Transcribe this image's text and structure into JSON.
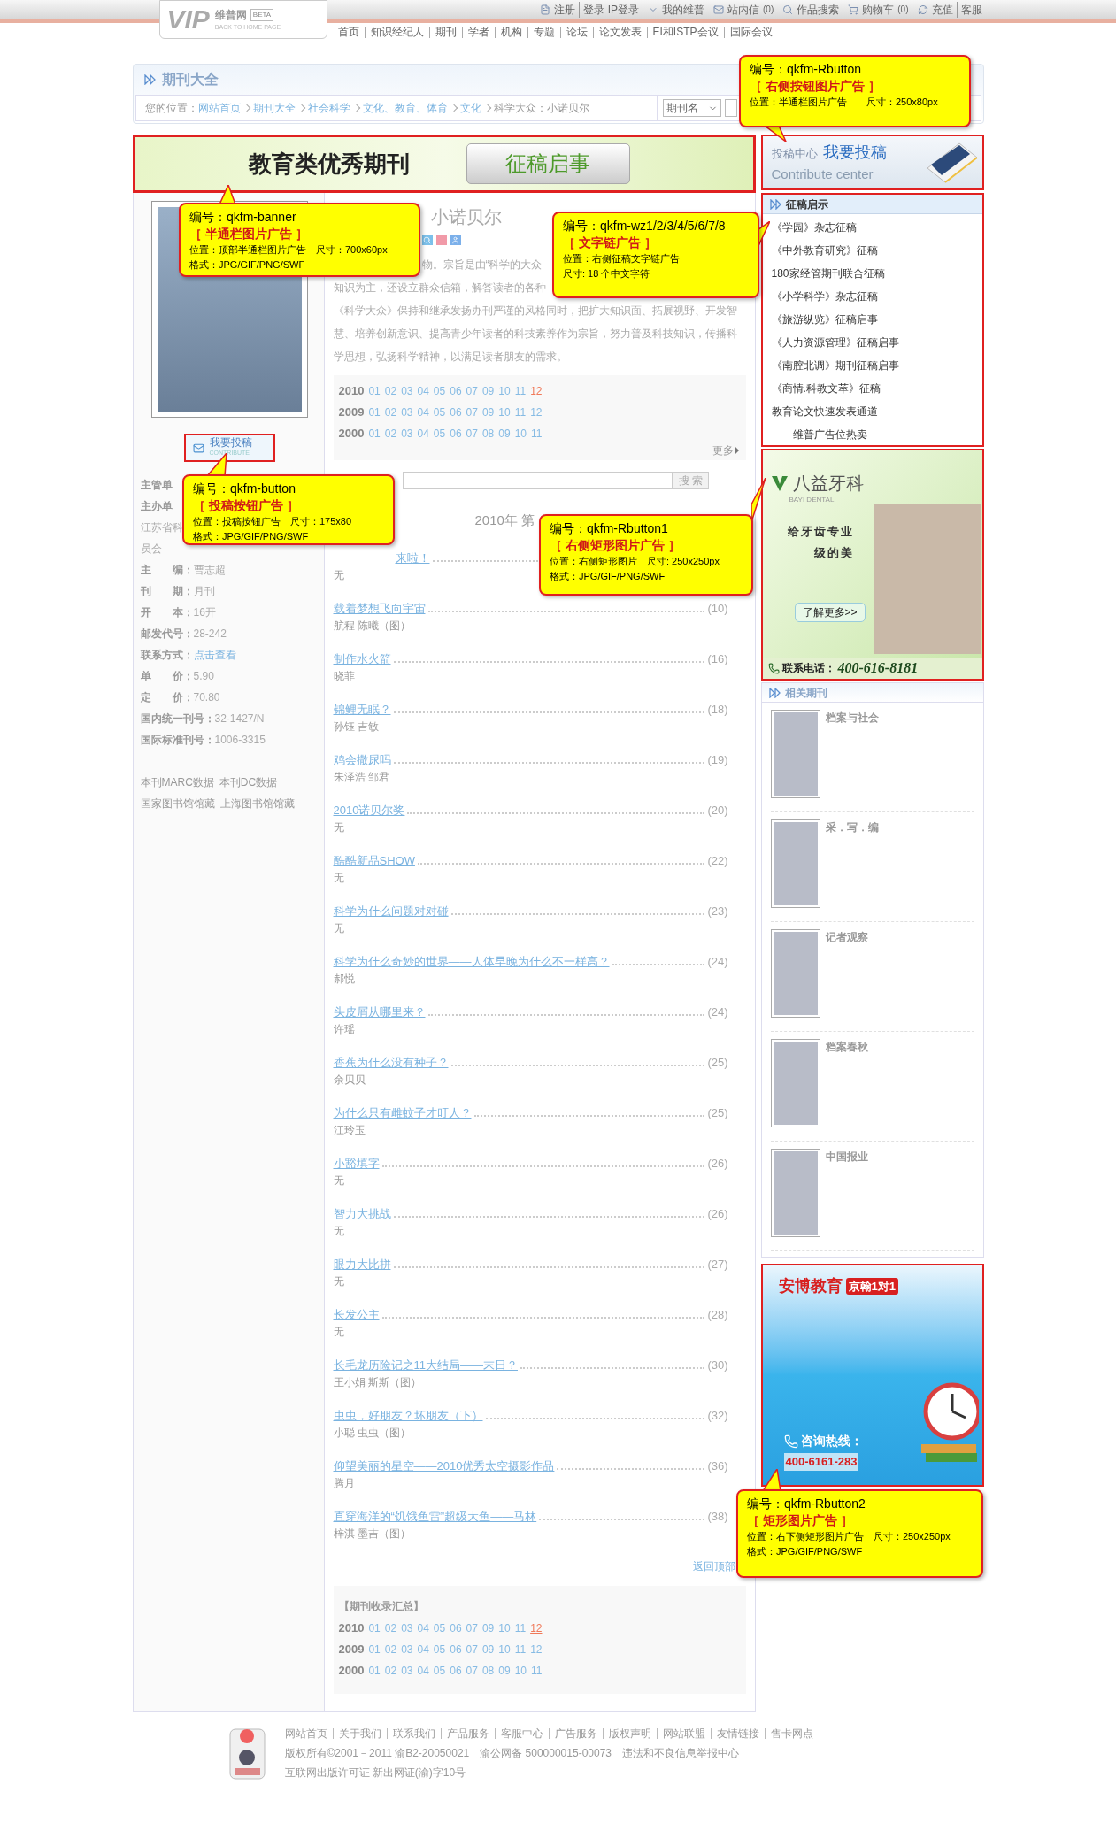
{
  "header": {
    "logo": {
      "mark": "VIP",
      "brand": "维普网",
      "badge": "BETA",
      "tagline": "BACK TO HOME PAGE"
    },
    "user_links": [
      {
        "kind": "register",
        "items": [
          "注册",
          "登录 IP登录"
        ]
      },
      {
        "kind": "account",
        "items": [
          "我的维普"
        ]
      },
      {
        "kind": "mail",
        "items": [
          "站内信"
        ],
        "count": "(0)"
      },
      {
        "kind": "search",
        "items": [
          "作品搜索"
        ]
      },
      {
        "kind": "cart",
        "items": [
          "购物车"
        ],
        "count": "(0)"
      },
      {
        "kind": "recharge",
        "items": [
          "充值",
          "客服"
        ]
      }
    ],
    "nav": [
      "首页",
      "知识经纪人",
      "期刊",
      "学者",
      "机构",
      "专题",
      "论坛",
      "论文发表",
      "EI和ISTP会议",
      "国际会议"
    ]
  },
  "section": {
    "title": "期刊大全",
    "breadcrumb": {
      "label": "您的位置：",
      "links": [
        "网站首页",
        "期刊大全",
        "社会科学",
        "文化、教育、体育",
        "文化"
      ],
      "current": "科学大众：小诺贝尔"
    },
    "search_select": "期刊名"
  },
  "banner_ad": {
    "headline": "教育类优秀期刊",
    "button": "征稿启事"
  },
  "journal_info": {
    "contribute_button": {
      "label": "我要投稿",
      "sublabel": "CONTRIBUTE"
    },
    "covered_lines": [
      {
        "kind": "label",
        "text": "主管单"
      },
      {
        "kind": "label",
        "text": "主办单"
      },
      {
        "kind": "text",
        "text": "江苏省科"
      },
      {
        "kind": "text",
        "text": "员会"
      }
    ],
    "rows": [
      {
        "label": "主　　编：",
        "value": "曹志超",
        "link": false
      },
      {
        "label": "刊　　期：",
        "value": "月刊",
        "link": false
      },
      {
        "label": "开　　本：",
        "value": "16开",
        "link": false
      },
      {
        "label": "邮发代号：",
        "value": "28-242",
        "link": false
      },
      {
        "label": "联系方式：",
        "value": "点击查看",
        "link": true
      },
      {
        "label": "单　　价：",
        "value": "5.90",
        "link": false
      },
      {
        "label": "定　　价：",
        "value": "70.80",
        "link": false
      },
      {
        "label": "国内统一刊号：",
        "value": "32-1427/N",
        "link": false
      },
      {
        "label": "国际标准刊号：",
        "value": "1006-3315",
        "link": false
      }
    ],
    "data_links": [
      [
        "本刊MARC数据",
        "本刊DC数据"
      ],
      [
        "国家图书馆馆藏",
        "上海图书馆馆藏"
      ]
    ]
  },
  "journal": {
    "title": "小诺贝尔",
    "description_fragments": [
      "物。宗旨是由“科学的大众",
      "知识为主，还设立群众信箱，解答读者的各种"
    ],
    "description": "《科学大众》保持和继承发扬办刊严谨的风格同时，把扩大知识面、拓展视野、开发智慧、培养创新意识、提高青少年读者的科技素养作为宗旨，努力普及科技知识，传播科学思想，弘扬科学精神，以满足读者朋友的需求。",
    "issues": [
      {
        "year": "2010",
        "issues": [
          {
            "label": "01",
            "selected": false
          },
          {
            "label": "02",
            "selected": false
          },
          {
            "label": "03",
            "selected": false
          },
          {
            "label": "04",
            "selected": false
          },
          {
            "label": "05",
            "selected": false
          },
          {
            "label": "06",
            "selected": false
          },
          {
            "label": "07",
            "selected": false
          },
          {
            "label": "09",
            "selected": false
          },
          {
            "label": "10",
            "selected": false
          },
          {
            "label": "11",
            "selected": false
          },
          {
            "label": "12",
            "selected": true
          }
        ]
      },
      {
        "year": "2009",
        "issues": [
          {
            "label": "01",
            "selected": false
          },
          {
            "label": "02",
            "selected": false
          },
          {
            "label": "03",
            "selected": false
          },
          {
            "label": "04",
            "selected": false
          },
          {
            "label": "05",
            "selected": false
          },
          {
            "label": "06",
            "selected": false
          },
          {
            "label": "07",
            "selected": false
          },
          {
            "label": "09",
            "selected": false
          },
          {
            "label": "10",
            "selected": false
          },
          {
            "label": "11",
            "selected": false
          },
          {
            "label": "12",
            "selected": false
          }
        ]
      },
      {
        "year": "2000",
        "issues": [
          {
            "label": "01",
            "selected": false
          },
          {
            "label": "02",
            "selected": false
          },
          {
            "label": "03",
            "selected": false
          },
          {
            "label": "04",
            "selected": false
          },
          {
            "label": "05",
            "selected": false
          },
          {
            "label": "06",
            "selected": false
          },
          {
            "label": "07",
            "selected": false
          },
          {
            "label": "08",
            "selected": false
          },
          {
            "label": "09",
            "selected": false
          },
          {
            "label": "10",
            "selected": false
          },
          {
            "label": "11",
            "selected": false
          }
        ]
      }
    ],
    "more": "更多",
    "search_button": "搜 索",
    "issue_heading": "2010年 第"
  },
  "articles": [
    {
      "title": "来啦！",
      "authors": "无"
    },
    {
      "title": "载着梦想飞向宇宙",
      "page": "(10)",
      "authors": "航程 陈曦（图）"
    },
    {
      "title": "制作水火箭",
      "page": "(16)",
      "authors": "晓菲"
    },
    {
      "title": "锦鲤无眠？",
      "page": "(18)",
      "authors": "孙钰 吉敏"
    },
    {
      "title": "鸡会撒尿吗",
      "page": "(19)",
      "authors": "朱泽浩 邹君"
    },
    {
      "title": "2010诺贝尔奖",
      "page": "(20)",
      "authors": "无"
    },
    {
      "title": "酷酷新品SHOW",
      "page": "(22)",
      "authors": "无"
    },
    {
      "title": "科学为什么问题对对碰",
      "page": "(23)",
      "authors": "无"
    },
    {
      "title": "科学为什么奇妙的世界——人体早晚为什么不一样高？",
      "page": "(24)",
      "authors": "郝悦"
    },
    {
      "title": "头皮屑从哪里来？",
      "page": "(24)",
      "authors": "许瑶"
    },
    {
      "title": "香蕉为什么没有种子？",
      "page": "(25)",
      "authors": "余贝贝"
    },
    {
      "title": "为什么只有雌蚊子才叮人？",
      "page": "(25)",
      "authors": "江玲玉"
    },
    {
      "title": "小豁填字",
      "page": "(26)",
      "authors": "无"
    },
    {
      "title": "智力大挑战",
      "page": "(26)",
      "authors": "无"
    },
    {
      "title": "眼力大比拼",
      "page": "(27)",
      "authors": "无"
    },
    {
      "title": "长发公主",
      "page": "(28)",
      "authors": "无"
    },
    {
      "title": "长毛龙历险记之11大结局——末日？",
      "page": "(30)",
      "authors": "王小娟 斯斯（图）"
    },
    {
      "title": "虫虫，好朋友？坏朋友（下）",
      "page": "(32)",
      "authors": "小聪 虫虫（图）"
    },
    {
      "title": "仰望美丽的星空——2010优秀太空摄影作品",
      "page": "(36)",
      "authors": "腾月"
    },
    {
      "title": "直穿海洋的“饥饿鱼雷”超级大鱼——马林",
      "page": "(38)",
      "authors": "梓淇 墨吉（图）"
    }
  ],
  "back_to_top": "返回顶部",
  "archive": {
    "title": "【期刊收录汇总】",
    "years": [
      {
        "year": "2010",
        "issues": [
          {
            "label": "01",
            "selected": false
          },
          {
            "label": "02",
            "selected": false
          },
          {
            "label": "03",
            "selected": false
          },
          {
            "label": "04",
            "selected": false
          },
          {
            "label": "05",
            "selected": false
          },
          {
            "label": "06",
            "selected": false
          },
          {
            "label": "07",
            "selected": false
          },
          {
            "label": "09",
            "selected": false
          },
          {
            "label": "10",
            "selected": false
          },
          {
            "label": "11",
            "selected": false
          },
          {
            "label": "12",
            "selected": true
          }
        ]
      },
      {
        "year": "2009",
        "issues": [
          {
            "label": "01",
            "selected": false
          },
          {
            "label": "02",
            "selected": false
          },
          {
            "label": "03",
            "selected": false
          },
          {
            "label": "04",
            "selected": false
          },
          {
            "label": "05",
            "selected": false
          },
          {
            "label": "06",
            "selected": false
          },
          {
            "label": "07",
            "selected": false
          },
          {
            "label": "09",
            "selected": false
          },
          {
            "label": "10",
            "selected": false
          },
          {
            "label": "11",
            "selected": false
          },
          {
            "label": "12",
            "selected": false
          }
        ]
      },
      {
        "year": "2000",
        "issues": [
          {
            "label": "01",
            "selected": false
          },
          {
            "label": "02",
            "selected": false
          },
          {
            "label": "03",
            "selected": false
          },
          {
            "label": "04",
            "selected": false
          },
          {
            "label": "05",
            "selected": false
          },
          {
            "label": "06",
            "selected": false
          },
          {
            "label": "07",
            "selected": false
          },
          {
            "label": "08",
            "selected": false
          },
          {
            "label": "09",
            "selected": false
          },
          {
            "label": "10",
            "selected": false
          },
          {
            "label": "11",
            "selected": false
          }
        ]
      }
    ]
  },
  "sidebar": {
    "contribute_ad": {
      "label": "投稿中心",
      "headline": "我要投稿",
      "subtitle": "Contribute center"
    },
    "call_for_papers": {
      "title": "征稿启示",
      "items": [
        "《学园》杂志征稿",
        "《中外教育研究》征稿",
        "180家经管期刊联合征稿",
        "《小学科学》杂志征稿",
        "《旅游纵览》征稿启事",
        "《人力资源管理》征稿启事",
        "《南腔北调》期刊征稿启事",
        "《商情.科教文萃》征稿",
        "教育论文快速发表通道",
        "——维普广告位热卖——"
      ]
    },
    "dental_ad": {
      "brand": "八益牙科",
      "brand_en": "BAYI DENTAL",
      "slogan": [
        "给牙齿专业",
        "级的美"
      ],
      "button": "了解更多>>",
      "phone_label": "联系电话：",
      "phone": "400-616-8181"
    },
    "related": {
      "title": "相关期刊",
      "items": [
        "档案与社会",
        "采．写．编",
        "记者观察",
        "档案春秋",
        "中国报业"
      ]
    },
    "edu_ad": {
      "brand": "安博教育",
      "tag": "京翰1对1",
      "hotline_label": "咨询热线：",
      "hotline": "400-6161-283"
    }
  },
  "footer": {
    "links": [
      "网站首页",
      "关于我们",
      "联系我们",
      "产品服务",
      "客服中心",
      "广告服务",
      "版权声明",
      "网站联盟",
      "友情链接",
      "售卡网点"
    ],
    "copyright": "版权所有©2001－2011 渝B2-20050021　渝公网备 500000015-00073　违法和不良信息举报中心",
    "license": "互联网出版许可证 新出网证(渝)字10号"
  },
  "callouts": [
    {
      "code": "编号：qkfm-Rbutton",
      "type": "［ 右侧按钮图片广告 ］",
      "lines": [
        "位置：半通栏图片广告　　尺寸：250x80px"
      ]
    },
    {
      "code": "编号：qkfm-banner",
      "type": "［ 半通栏图片广告 ］",
      "lines": [
        "位置：顶部半通栏图片广告　尺寸：700x60px",
        "格式：JPG/GIF/PNG/SWF"
      ]
    },
    {
      "code": "编号：qkfm-wz1/2/3/4/5/6/7/8",
      "type": "［ 文字链广告 ］",
      "lines": [
        "位置：右侧征稿文字链广告",
        "尺寸: 18 个中文字符"
      ]
    },
    {
      "code": "编号：qkfm-button",
      "type": "［ 投稿按钮广告 ］",
      "lines": [
        "位置：投稿按钮广告　尺寸：175x80",
        "格式：JPG/GIF/PNG/SWF"
      ]
    },
    {
      "code": "编号：qkfm-Rbutton1",
      "type": "［ 右侧矩形图片广告 ］",
      "lines": [
        "位置：右侧矩形图片　尺寸: 250x250px",
        "格式：JPG/GIF/PNG/SWF"
      ]
    },
    {
      "code": "编号：qkfm-Rbutton2",
      "type": "［ 矩形图片广告 ］",
      "lines": [
        "位置：右下侧矩形图片广告　尺寸：250x250px",
        "格式：JPG/GIF/PNG/SWF"
      ]
    }
  ]
}
